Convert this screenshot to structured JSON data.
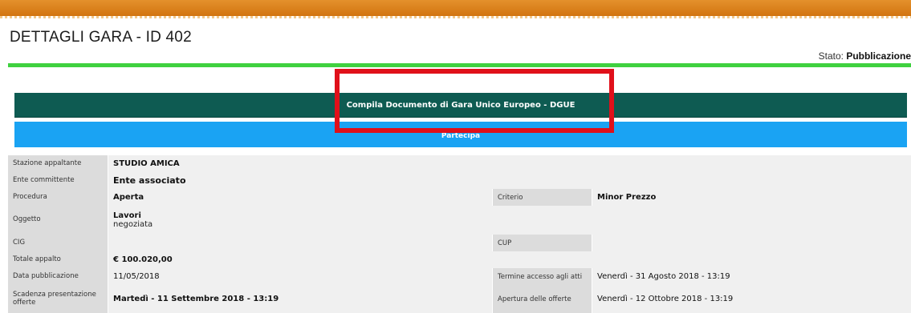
{
  "header": {
    "title": "DETTAGLI GARA - ID 402",
    "status_label": "Stato:",
    "status_value": "Pubblicazione"
  },
  "buttons": {
    "dgue_label": "Compila Documento di Gara Unico Europeo - DGUE",
    "partecipa_label": "Partecipa"
  },
  "highlight": {
    "color": "#e0101a"
  },
  "details": {
    "stazione_appaltante": {
      "label": "Stazione appaltante",
      "value": "STUDIO AMICA"
    },
    "ente_committente": {
      "label": "Ente committente",
      "value": "Ente associato"
    },
    "procedura": {
      "label": "Procedura",
      "value": "Aperta"
    },
    "criterio": {
      "label": "Criterio",
      "value": "Minor Prezzo"
    },
    "oggetto": {
      "label": "Oggetto",
      "value": "Lavori",
      "value_sub": "negoziata"
    },
    "cig": {
      "label": "CIG",
      "value": ""
    },
    "cup": {
      "label": "CUP",
      "value": ""
    },
    "totale_appalto": {
      "label": "Totale appalto",
      "value": "€ 100.020,00"
    },
    "data_pubblicazione": {
      "label": "Data pubblicazione",
      "value": "11/05/2018"
    },
    "termine_accesso": {
      "label": "Termine accesso agli atti",
      "value": "Venerdì - 31 Agosto 2018 - 13:19"
    },
    "scadenza_offerte": {
      "label": "Scadenza presentazione offerte",
      "value": "Martedì - 11 Settembre 2018 - 13:19"
    },
    "apertura_offerte": {
      "label": "Apertura delle offerte",
      "value": "Venerdì - 12 Ottobre 2018 - 13:19"
    }
  },
  "colors": {
    "top_bar": "#d27410",
    "green_rule": "#3fd13f",
    "dgue_button": "#0e5b52",
    "partecipa_button": "#1aa3f3"
  }
}
